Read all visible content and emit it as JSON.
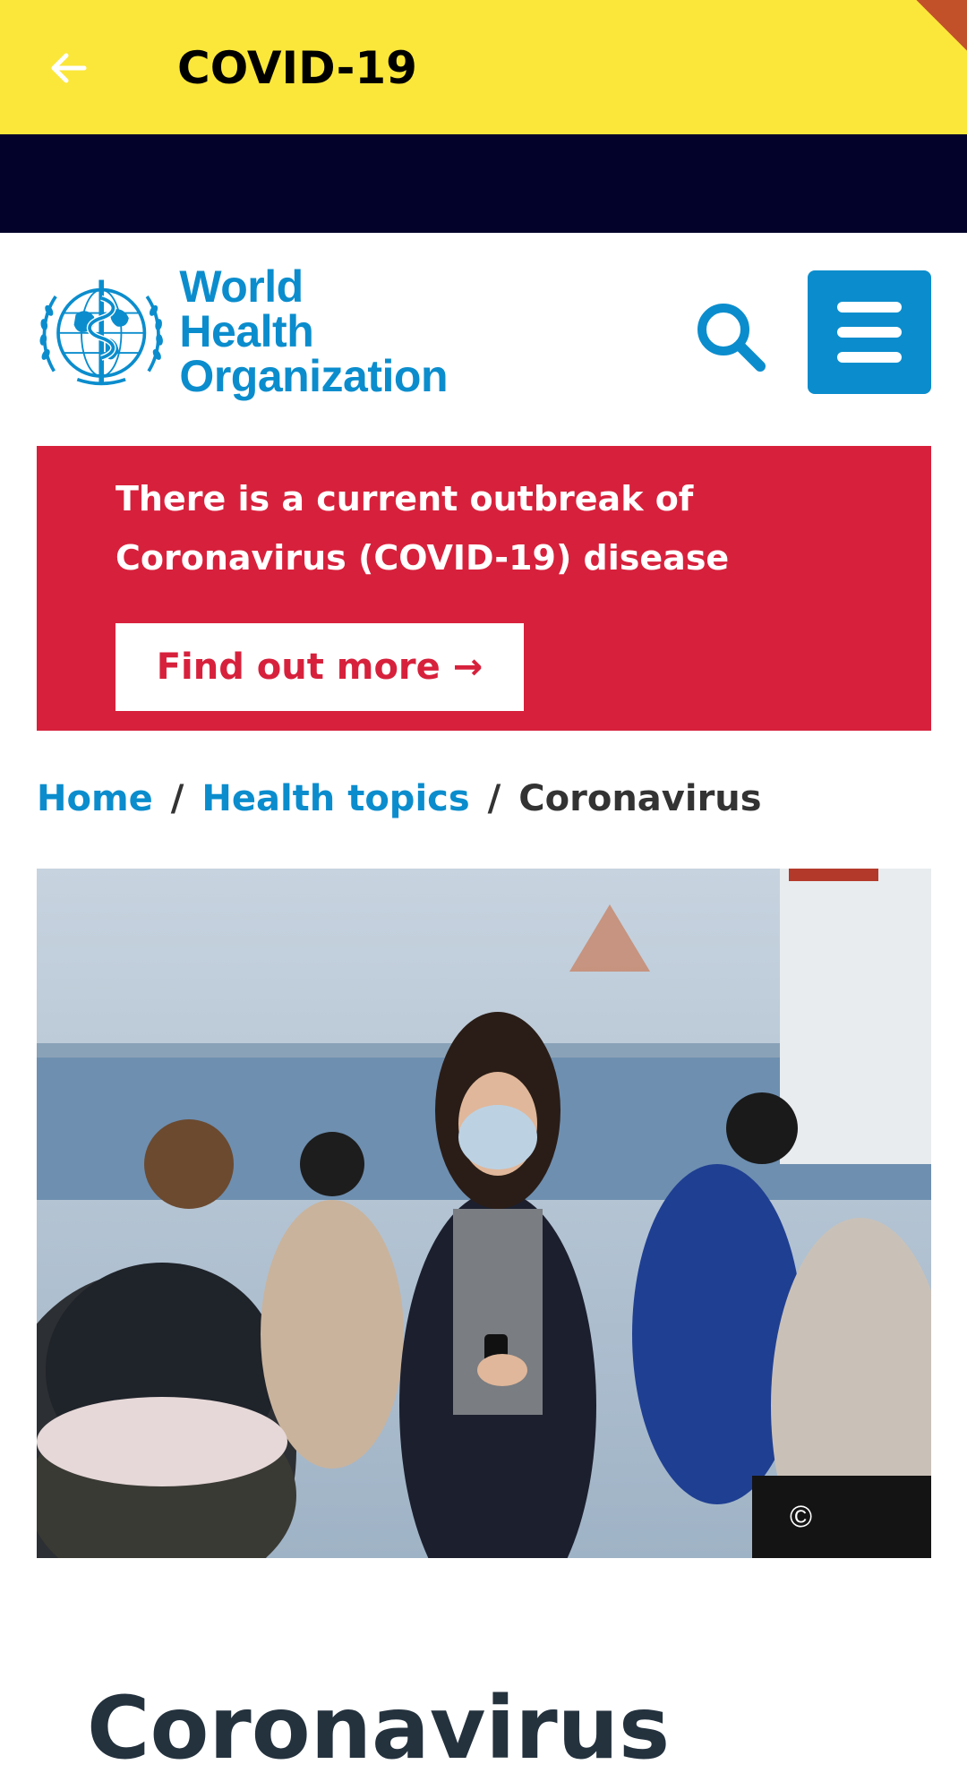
{
  "app_bar": {
    "title": "COVID-19",
    "back_icon": "arrow-left-icon",
    "background": "#fbe73a",
    "ribbon_color": "#c2512a"
  },
  "band_color": "#02022a",
  "site_header": {
    "logo": {
      "line1": "World Health",
      "line2": "Organization",
      "emblem_icon": "who-emblem-icon"
    },
    "search_icon": "magnifier-icon",
    "menu_icon": "hamburger-icon",
    "brand_color": "#0b8dcd"
  },
  "alert": {
    "line1": "There is a current outbreak of",
    "line2": "Coronavirus (COVID-19) disease",
    "cta_label": "Find out more",
    "cta_arrow": "→",
    "color": "#d7213c"
  },
  "breadcrumb": {
    "items": [
      "Home",
      "Health topics",
      "Coronavirus"
    ],
    "separator": "/"
  },
  "hero": {
    "copyright": "©"
  },
  "page_title": "Coronavirus"
}
